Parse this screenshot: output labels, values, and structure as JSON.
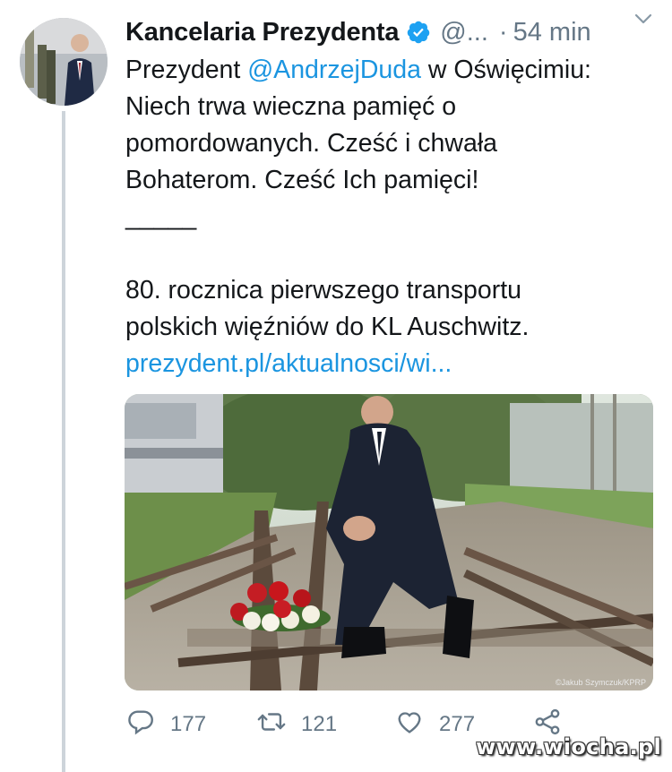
{
  "tweet": {
    "author_name": "Kancelaria Prezydenta",
    "handle": "@...",
    "separator": "·",
    "time": "54 min",
    "text": {
      "prefix": "Prezydent ",
      "mention": "@AndrzejDuda",
      "line1_rest": " w Oświęcimiu:",
      "line2": "Niech trwa wieczna pamięć o",
      "line3": "pomordowanych. Cześć i chwała",
      "line4": "Bohaterom. Cześć Ich pamięci!",
      "divider": "_____",
      "line5": "80. rocznica pierwszego transportu",
      "line6": "polskich więźniów do KL Auschwitz.",
      "link": "prezydent.pl/aktualnosci/wi..."
    },
    "photo_credit": "©Jakub Szymczuk/KPRP",
    "actions": {
      "reply_count": "177",
      "retweet_count": "121",
      "like_count": "277"
    }
  },
  "watermark": "www.wiocha.pl",
  "icons": {
    "verified": "verified-badge-icon",
    "caret": "chevron-down-icon",
    "reply": "reply-icon",
    "retweet": "retweet-icon",
    "like": "heart-icon",
    "share": "share-icon"
  },
  "colors": {
    "link": "#1b95e0",
    "secondary_text": "#657786",
    "thread_line": "#cdd4da"
  }
}
